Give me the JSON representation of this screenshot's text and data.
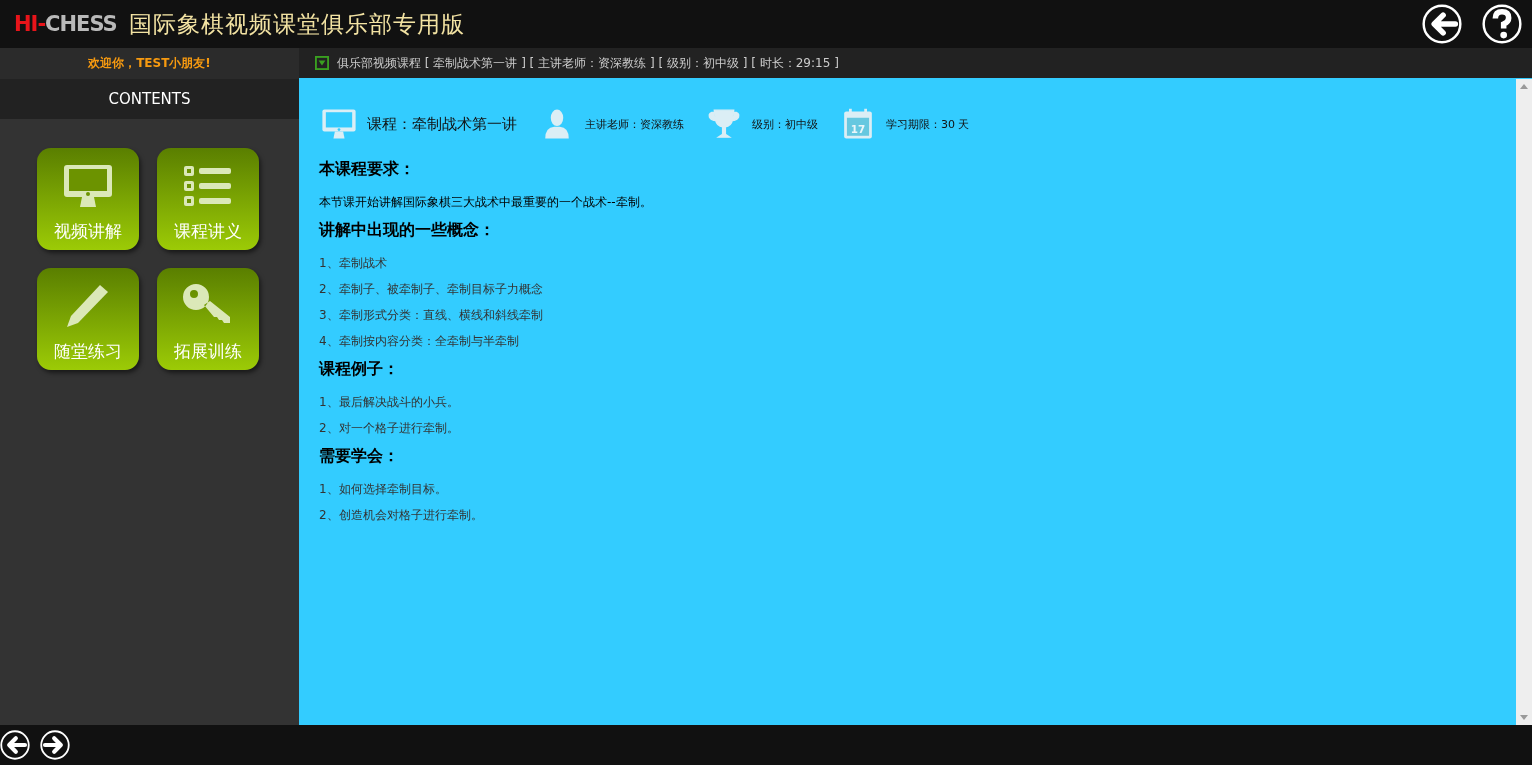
{
  "header": {
    "logo_prefix": "HI-",
    "logo_name": "CHESS",
    "title": "国际象棋视频课堂俱乐部专用版"
  },
  "welcome": "欢迎你，TEST小朋友!",
  "breadcrumb": "俱乐部视频课程 [ 牵制战术第一讲 ] [ 主讲老师：资深教练 ] [ 级别：初中级 ] [ 时长：29:15 ]",
  "contents_title": "CONTENTS",
  "tiles": [
    {
      "kind": "monitor",
      "label": "视频讲解"
    },
    {
      "kind": "list",
      "label": "课程讲义"
    },
    {
      "kind": "pencil",
      "label": "随堂练习"
    },
    {
      "kind": "key",
      "label": "拓展训练"
    }
  ],
  "course_info": [
    {
      "kind": "monitor",
      "text": "课程：牵制战术第一讲"
    },
    {
      "kind": "person",
      "text": "主讲老师：资深教练"
    },
    {
      "kind": "trophy",
      "text": "级别：初中级"
    },
    {
      "kind": "calendar",
      "icon_text": "17",
      "text": "学习期限：30 天"
    }
  ],
  "sections": [
    {
      "heading": "本课程要求：",
      "items": [
        "本节课开始讲解国际象棋三大战术中最重要的一个战术--牵制。"
      ]
    },
    {
      "heading": "讲解中出现的一些概念：",
      "items": [
        "1、牵制战术",
        "2、牵制子、被牵制子、牵制目标子力概念",
        "3、牵制形式分类：直线、横线和斜线牵制",
        "4、牵制按内容分类：全牵制与半牵制"
      ]
    },
    {
      "heading": "课程例子：",
      "items": [
        "1、最后解决战斗的小兵。",
        "2、对一个格子进行牵制。"
      ]
    },
    {
      "heading": "需要学会：",
      "items": [
        "1、如何选择牵制目标。",
        "2、创造机会对格子进行牵制。"
      ]
    }
  ]
}
